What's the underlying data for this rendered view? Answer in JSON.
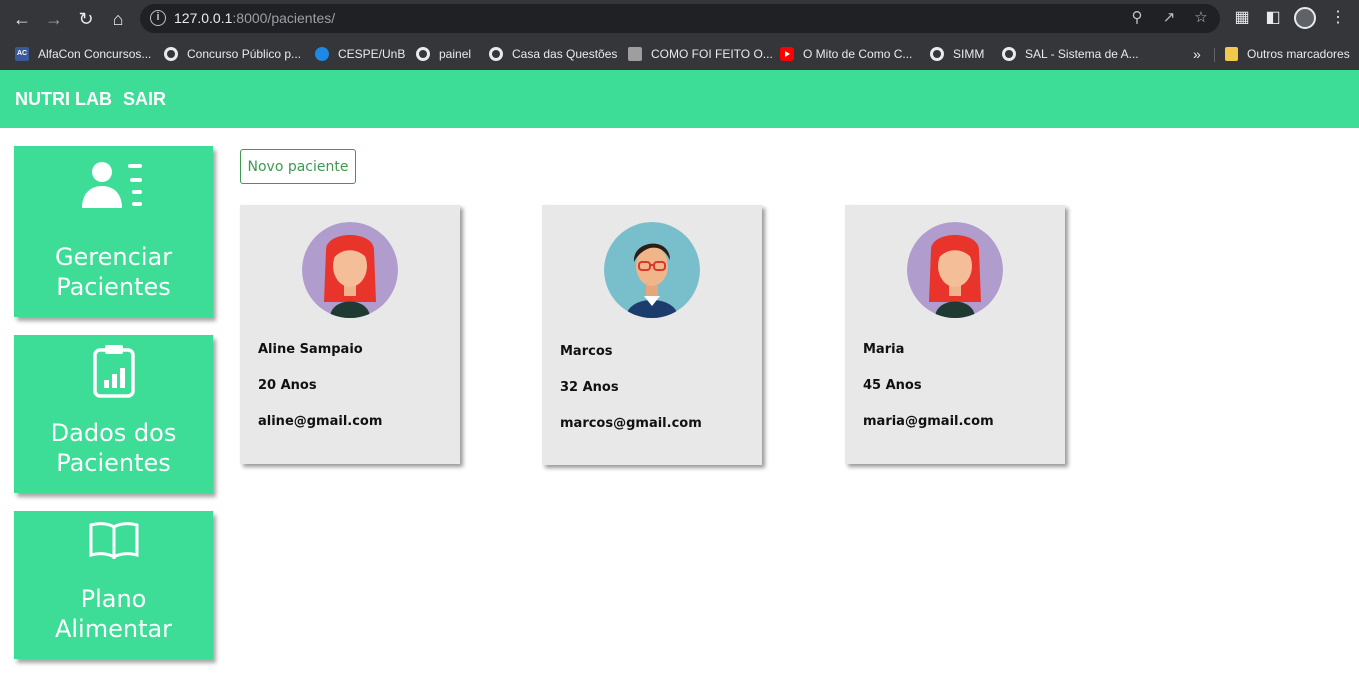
{
  "browser": {
    "url_host": "127.0.0.1",
    "url_rest": ":8000/pacientes/",
    "bookmarks": [
      {
        "label": "AlfaCon Concursos...",
        "icon": "ac"
      },
      {
        "label": "Concurso Público p...",
        "icon": "globe"
      },
      {
        "label": "CESPE/UnB",
        "icon": "cespe"
      },
      {
        "label": "painel",
        "icon": "globe"
      },
      {
        "label": "Casa das Questões",
        "icon": "globe"
      },
      {
        "label": "COMO FOI FEITO O...",
        "icon": "video"
      },
      {
        "label": "O Mito de Como C...",
        "icon": "yt"
      },
      {
        "label": "SIMM",
        "icon": "globe"
      },
      {
        "label": "SAL - Sistema de A...",
        "icon": "globe"
      }
    ],
    "overflow": "»",
    "other_bookmarks": "Outros marcadores"
  },
  "header": {
    "brand": "NUTRI LAB",
    "logout": "SAIR",
    "color": "#3ddc97"
  },
  "sidebar": {
    "items": [
      {
        "line1": "Gerenciar",
        "line2": "Pacientes",
        "icon": "users-list-icon"
      },
      {
        "line1": "Dados dos",
        "line2": "Pacientes",
        "icon": "clipboard-chart-icon"
      },
      {
        "line1": "Plano",
        "line2": "Alimentar",
        "icon": "open-book-icon"
      }
    ]
  },
  "main": {
    "new_patient_button": "Novo paciente",
    "patients": [
      {
        "name": "Aline Sampaio",
        "age": "20 Anos",
        "email": "aline@gmail.com",
        "avatar": "female"
      },
      {
        "name": "Marcos",
        "age": "32 Anos",
        "email": "marcos@gmail.com",
        "avatar": "male"
      },
      {
        "name": "Maria",
        "age": "45 Anos",
        "email": "maria@gmail.com",
        "avatar": "female"
      }
    ]
  }
}
